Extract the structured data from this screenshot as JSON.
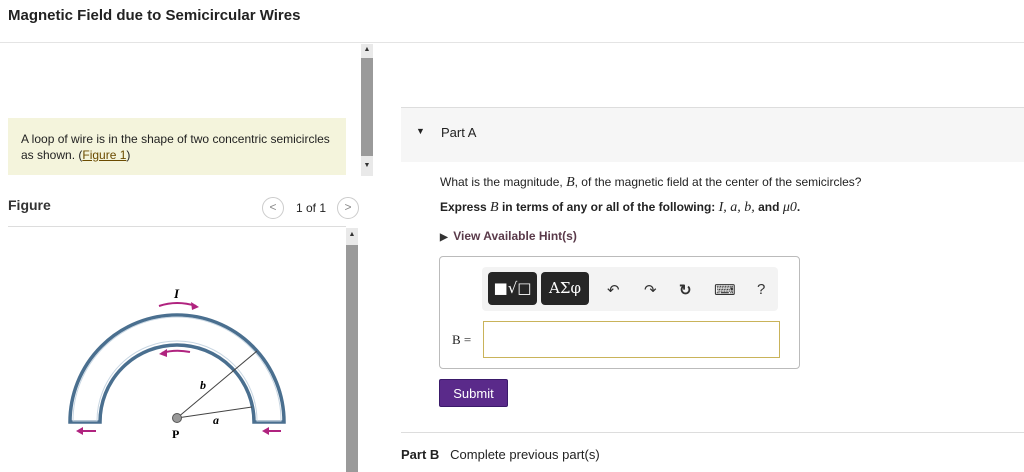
{
  "title": "Magnetic Field due to Semicircular Wires",
  "intro": {
    "text": "A loop of wire is in the shape of two concentric semicircles as shown. (",
    "link": "Figure 1",
    "close": ")"
  },
  "figure": {
    "label": "Figure",
    "pager": "1 of 1",
    "prev": "<",
    "next": ">",
    "labels": {
      "I": "I",
      "b": "b",
      "a": "a",
      "P": "P"
    }
  },
  "partA": {
    "label": "Part A",
    "question_pre": "What is the magnitude, ",
    "question_var": "B",
    "question_post": ", of the magnetic field at the center of the semicircles?",
    "express_pre": "Express ",
    "express_var": "B",
    "express_mid": " in terms of any or all of the following: ",
    "vars": "I, a, b,",
    "and": " and ",
    "mu": "μ0",
    "period": ".",
    "hint": "View Available Hint(s)",
    "toolbar": {
      "templates": "■√□",
      "greek": "ΑΣφ",
      "undo": "↶",
      "redo": "↷",
      "reset": "↻",
      "keyboard": "⌨",
      "help": "?"
    },
    "answer_label": "B =",
    "answer_value": "",
    "submit": "Submit"
  },
  "partB": {
    "label": "Part B",
    "status": "Complete previous part(s)"
  },
  "colors": {
    "wire": "#4a6f8f",
    "arrow": "#b0237f",
    "submit": "#5a2a8a"
  }
}
